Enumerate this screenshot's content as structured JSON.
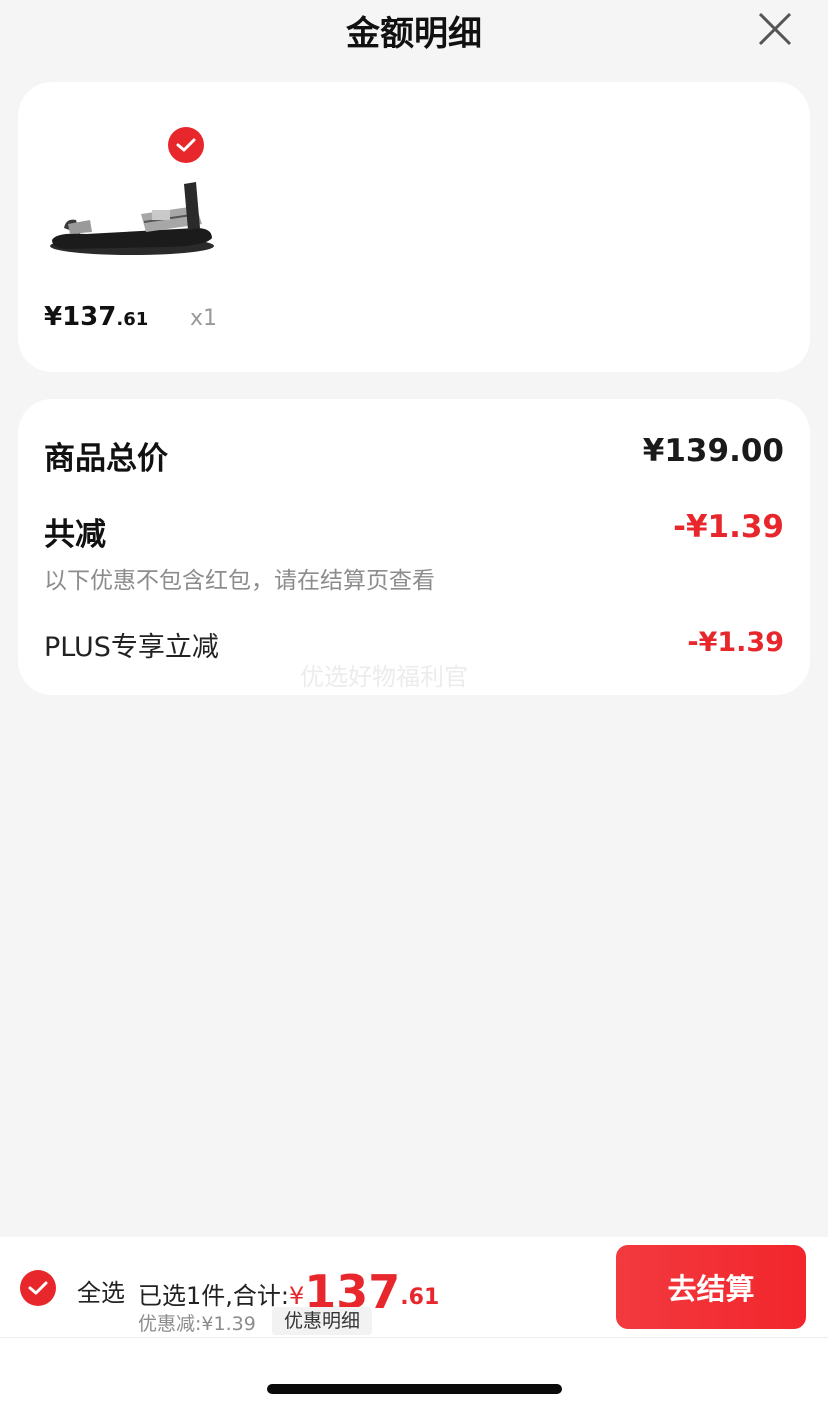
{
  "header": {
    "title": "金额明细",
    "close_icon": "close-icon"
  },
  "item": {
    "price_int": "¥137",
    "price_dec": ".61",
    "quantity": "x1",
    "selected": true
  },
  "summary_card": {
    "total_label": "商品总价",
    "total_value": "¥139.00",
    "reduce_label": "共减",
    "reduce_value": "-¥1.39",
    "reduce_note": "以下优惠不包含红包，请在结算页查看",
    "plus_label": "PLUS专享立减",
    "plus_value": "-¥1.39",
    "watermark": "优选好物福利官"
  },
  "bottom_bar": {
    "select_all_label": "全选",
    "summary_prefix": "已选1件,合计:",
    "currency": "¥",
    "total_int": "137",
    "total_dec": ".61",
    "discount_text": "优惠减:¥1.39",
    "detail_button": "优惠明细",
    "checkout_button": "去结算"
  },
  "colors": {
    "accent": "#e8272c",
    "background": "#f5f5f5",
    "card": "#ffffff"
  }
}
